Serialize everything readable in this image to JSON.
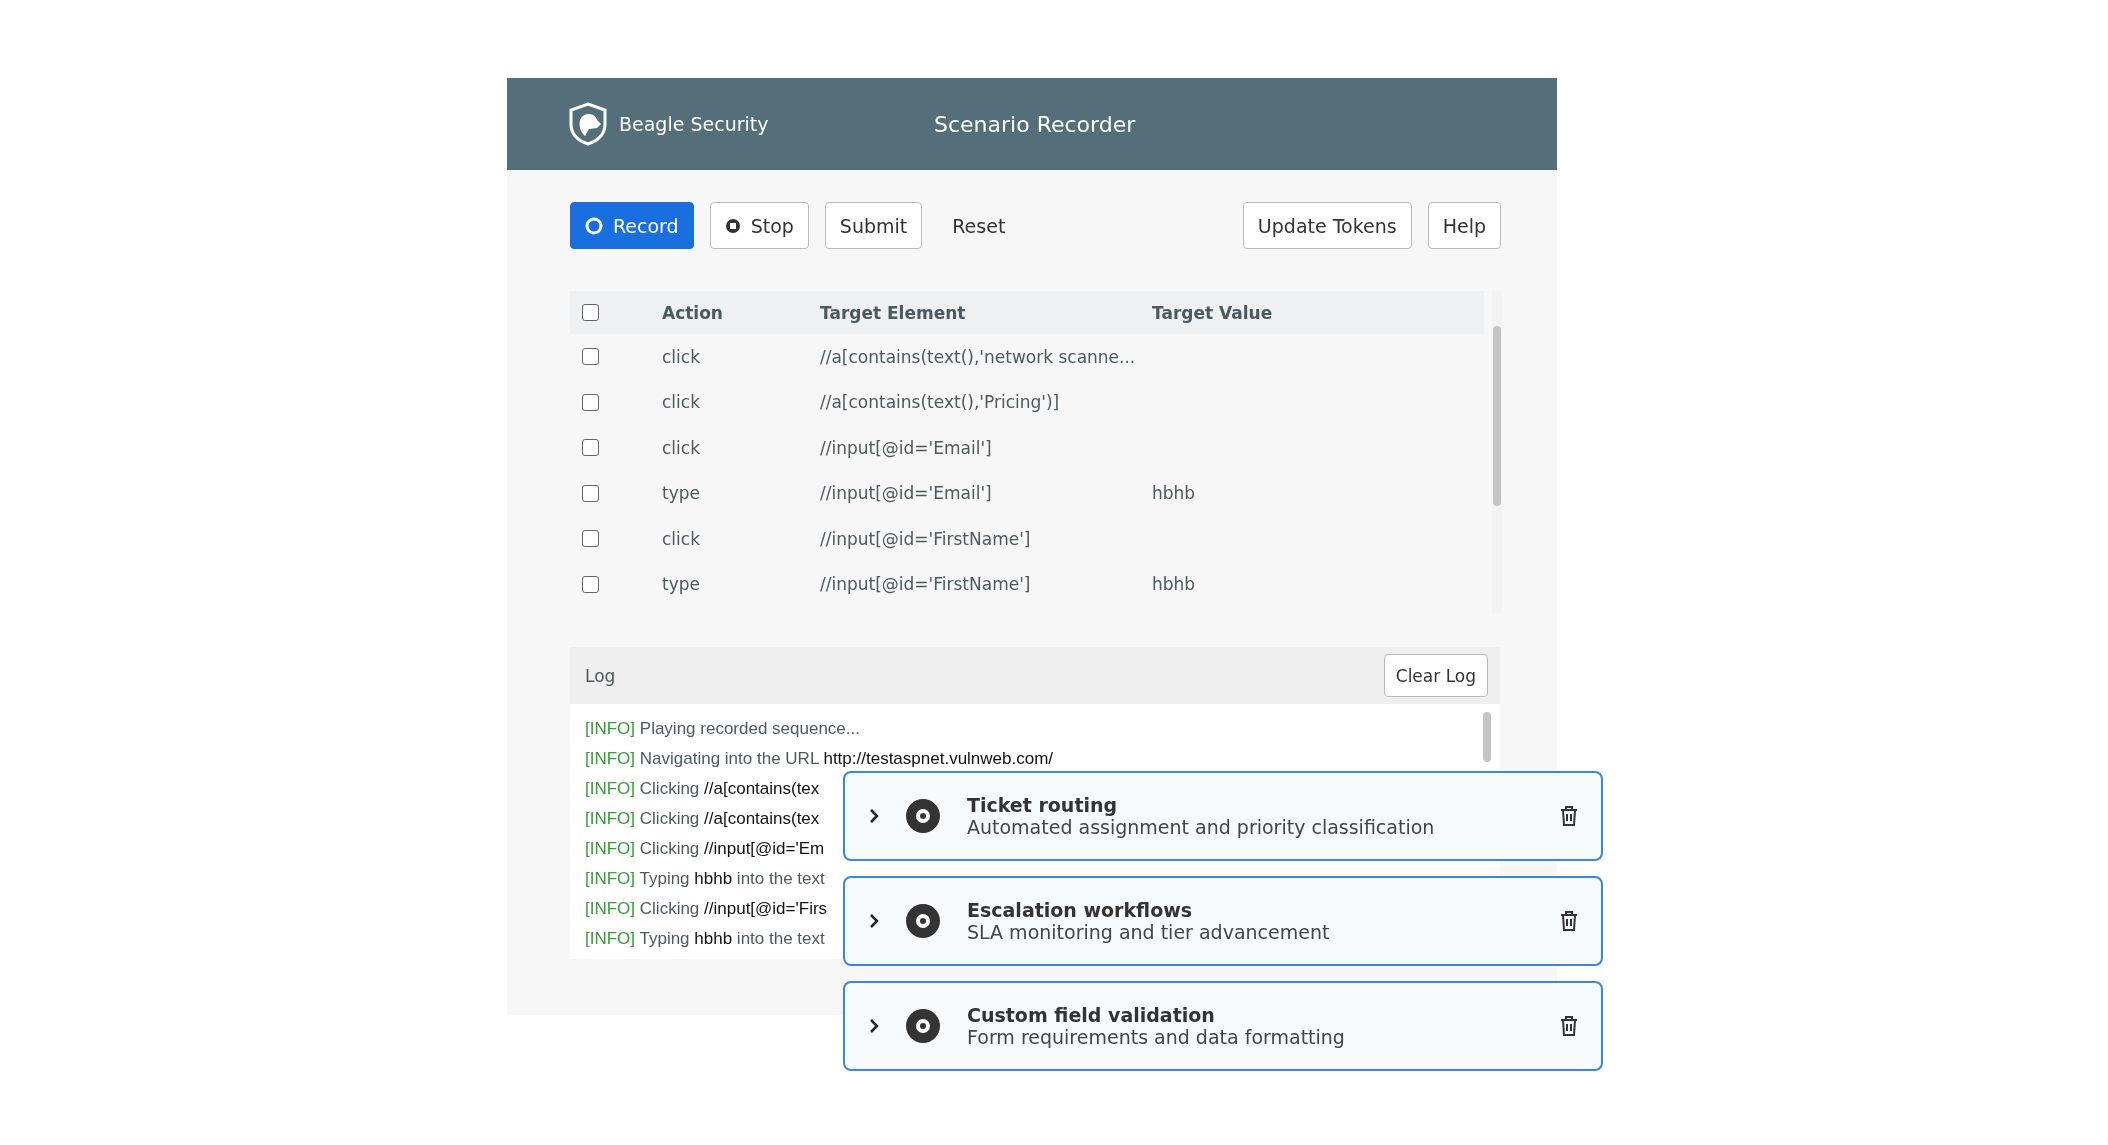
{
  "header": {
    "brand": "Beagle Security",
    "title": "Scenario Recorder"
  },
  "toolbar": {
    "left": [
      {
        "label": "Record",
        "kind": "record"
      },
      {
        "label": "Stop",
        "kind": "stop"
      },
      {
        "label": "Submit",
        "kind": "outline"
      },
      {
        "label": "Reset",
        "kind": "plain"
      }
    ],
    "right": [
      {
        "label": "Update Tokens",
        "kind": "outline"
      },
      {
        "label": "Help",
        "kind": "outline"
      }
    ]
  },
  "table": {
    "select_all": {
      "checked": false
    },
    "columns": [
      "Action",
      "Target Element",
      "Target Value"
    ],
    "rows": [
      {
        "checked": false,
        "action": "click",
        "target": "//a[contains(text(),'network scanne...",
        "value": ""
      },
      {
        "checked": false,
        "action": "click",
        "target": "//a[contains(text(),'Pricing')]",
        "value": ""
      },
      {
        "checked": false,
        "action": "click",
        "target": "//input[@id='Email']",
        "value": ""
      },
      {
        "checked": false,
        "action": "type",
        "target": "//input[@id='Email']",
        "value": "hbhb"
      },
      {
        "checked": false,
        "action": "click",
        "target": "//input[@id='FirstName']",
        "value": ""
      },
      {
        "checked": false,
        "action": "type",
        "target": "//input[@id='FirstName']",
        "value": "hbhb"
      }
    ]
  },
  "log": {
    "title": "Log",
    "clear_button": "Clear Log",
    "lines": [
      {
        "level": "[INFO]",
        "parts": [
          {
            "text": "Playing recorded sequence...",
            "emphasis": false
          }
        ]
      },
      {
        "level": "[INFO]",
        "parts": [
          {
            "text": "Navigating into the URL ",
            "emphasis": false
          },
          {
            "text": "http://testaspnet.vulnweb.com/",
            "emphasis": true
          }
        ]
      },
      {
        "level": "[INFO]",
        "parts": [
          {
            "text": "Clicking ",
            "emphasis": false
          },
          {
            "text": "//a[contains(tex",
            "emphasis": true
          }
        ]
      },
      {
        "level": "[INFO]",
        "parts": [
          {
            "text": "Clicking ",
            "emphasis": false
          },
          {
            "text": "//a[contains(tex",
            "emphasis": true
          }
        ]
      },
      {
        "level": "[INFO]",
        "parts": [
          {
            "text": "Clicking ",
            "emphasis": false
          },
          {
            "text": "//input[@id='Em",
            "emphasis": true
          }
        ]
      },
      {
        "level": "[INFO]",
        "parts": [
          {
            "text": "Typing ",
            "emphasis": false
          },
          {
            "text": "hbhb",
            "emphasis": true
          },
          {
            "text": " into the text",
            "emphasis": false
          }
        ]
      },
      {
        "level": "[INFO]",
        "parts": [
          {
            "text": "Clicking ",
            "emphasis": false
          },
          {
            "text": "//input[@id='Firs",
            "emphasis": true
          }
        ]
      },
      {
        "level": "[INFO]",
        "parts": [
          {
            "text": "Typing ",
            "emphasis": false
          },
          {
            "text": "hbhb",
            "emphasis": true
          },
          {
            "text": " into the text",
            "emphasis": false
          }
        ]
      }
    ]
  },
  "cards": [
    {
      "title": "Ticket routing",
      "subtitle": "Automated assignment and priority classification",
      "expanded": false
    },
    {
      "title": "Escalation workflows",
      "subtitle": "SLA monitoring and tier advancement",
      "expanded": false
    },
    {
      "title": "Custom field validation",
      "subtitle": "Form requirements and data formatting",
      "expanded": false
    }
  ]
}
